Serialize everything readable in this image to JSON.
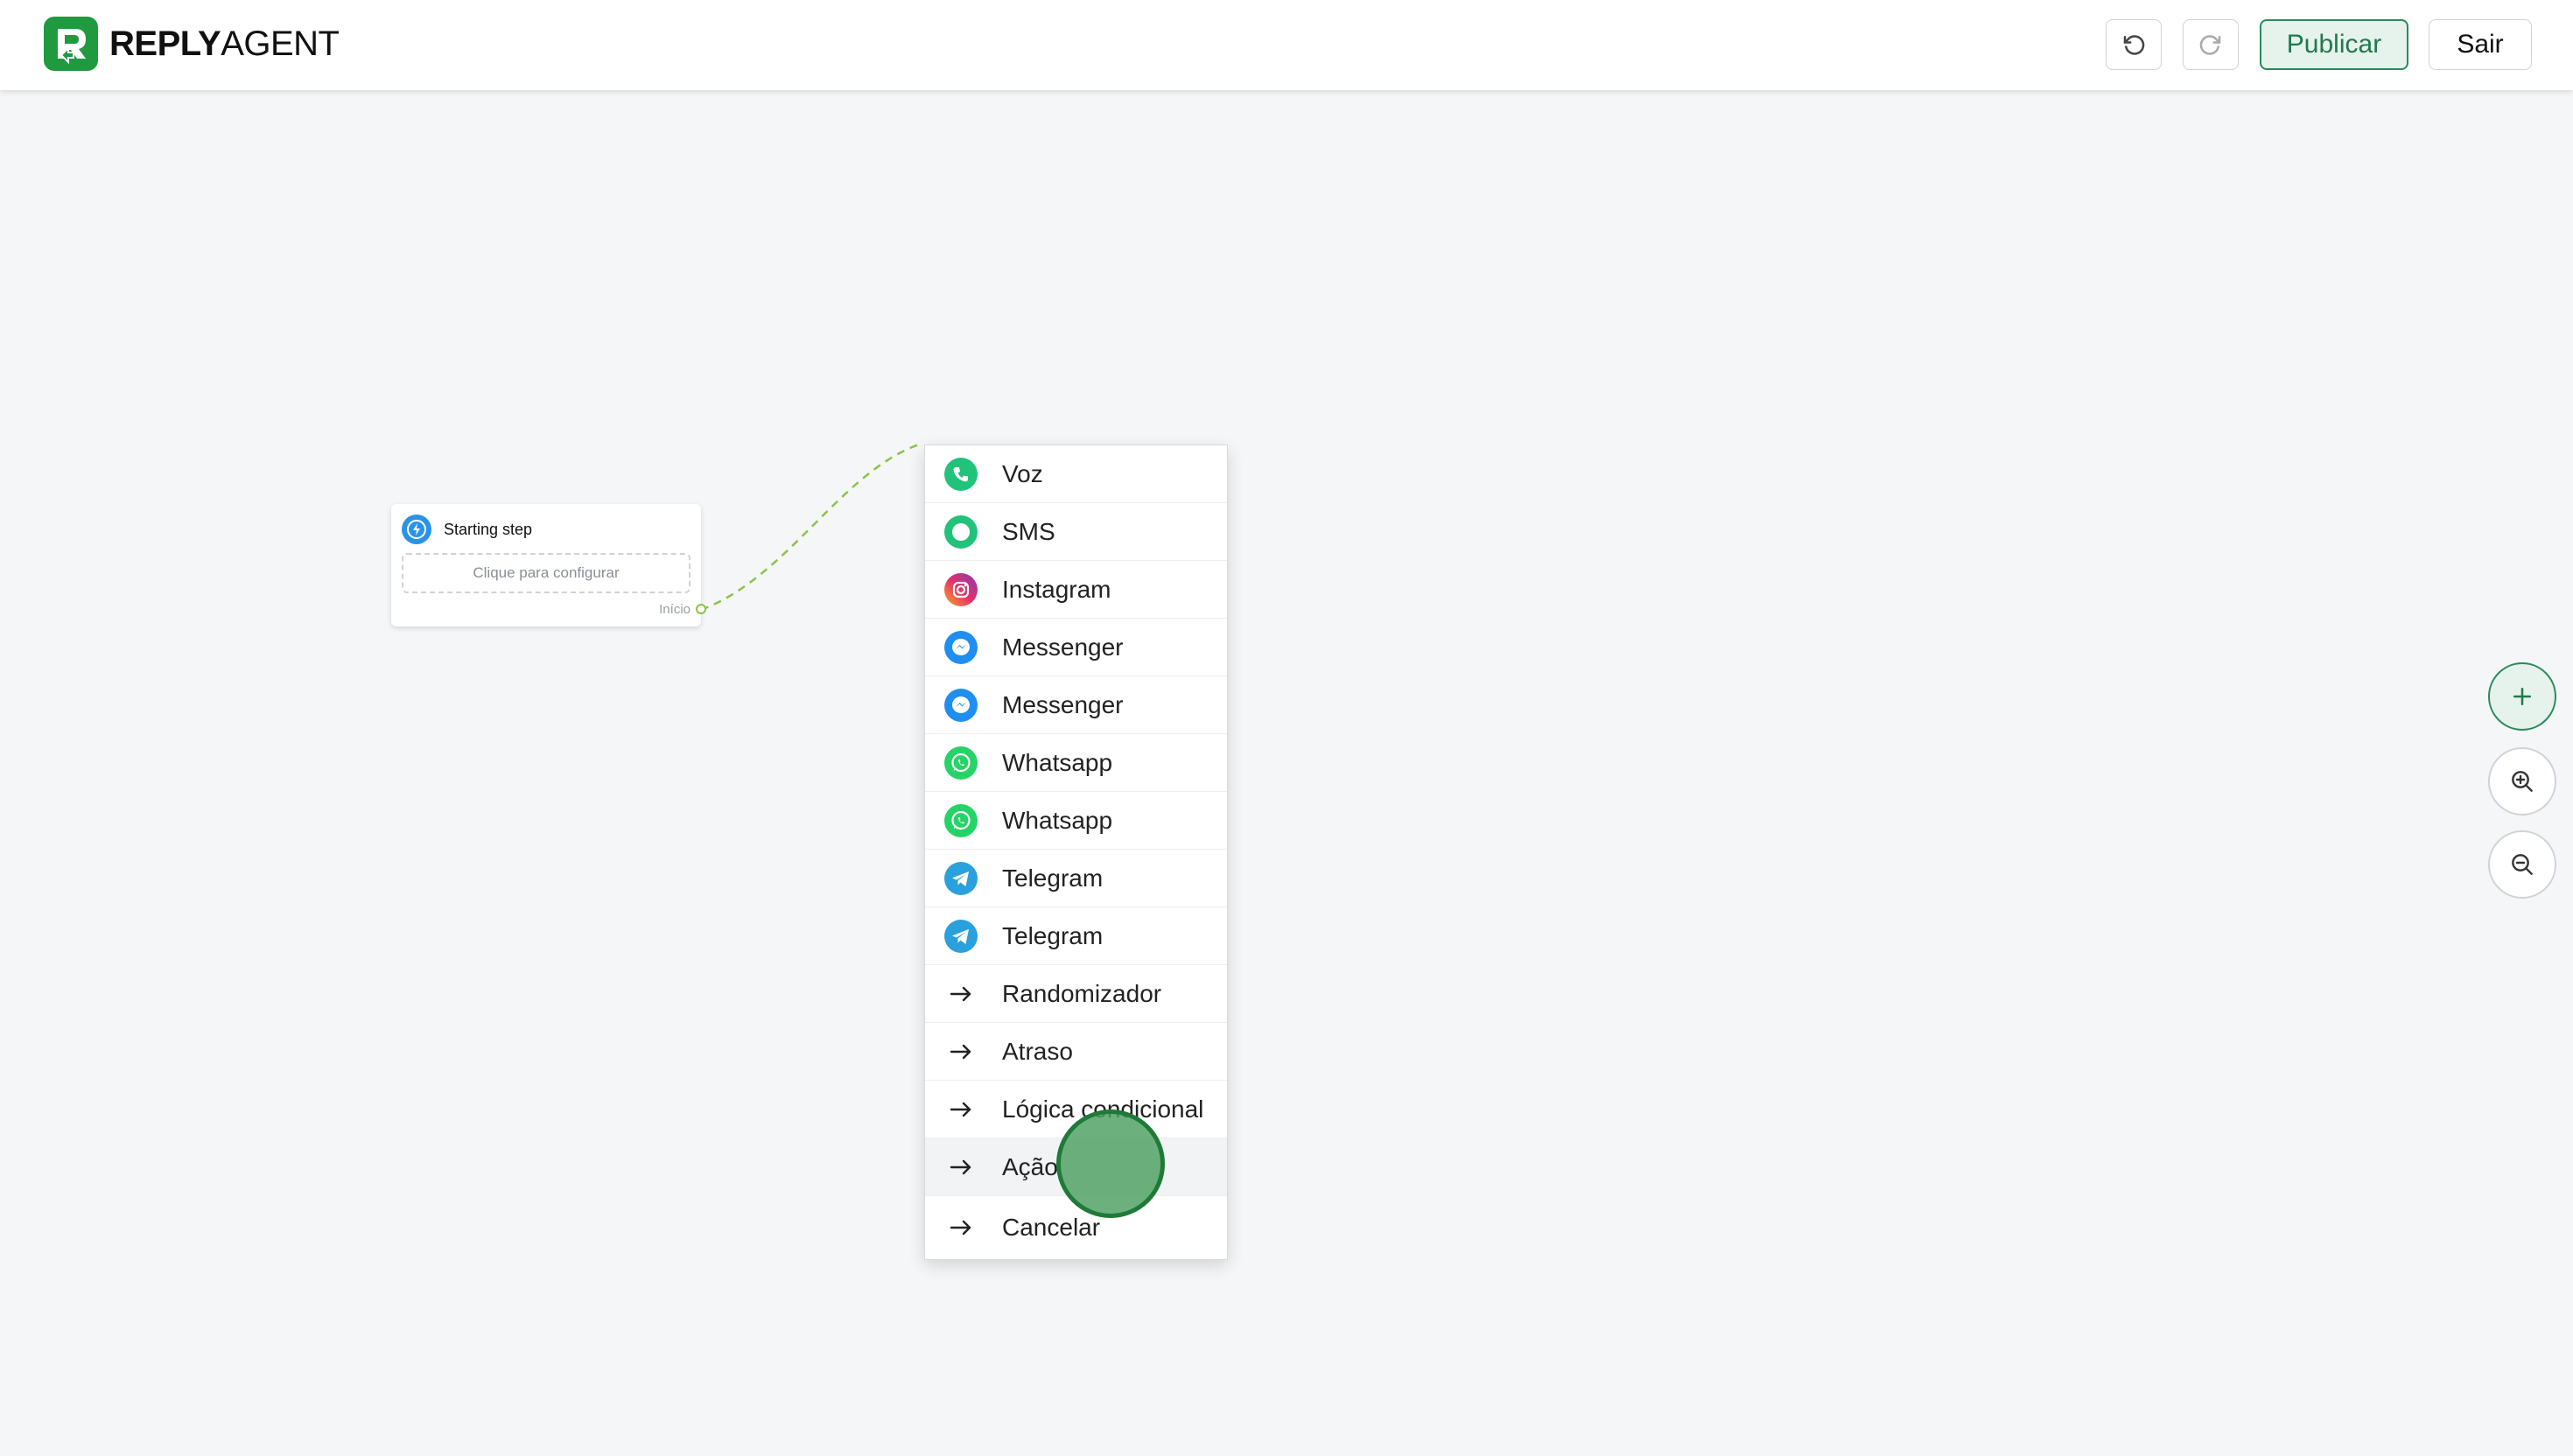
{
  "brand": {
    "name_bold": "REPLY",
    "name_regular": "AGENT",
    "accent_color": "#1f9a3f"
  },
  "toolbar": {
    "undo_icon": "undo-icon",
    "redo_icon": "redo-icon",
    "publish_label": "Publicar",
    "exit_label": "Sair"
  },
  "start_step": {
    "title": "Starting step",
    "config_placeholder": "Clique para configurar",
    "output_label": "Início"
  },
  "menu": {
    "items": [
      {
        "label": "Voz",
        "icon": "phone-icon"
      },
      {
        "label": "SMS",
        "icon": "sms-icon"
      },
      {
        "label": "Instagram",
        "icon": "instagram-icon"
      },
      {
        "label": "Messenger",
        "icon": "messenger-icon"
      },
      {
        "label": "Messenger",
        "icon": "messenger-icon"
      },
      {
        "label": "Whatsapp",
        "icon": "whatsapp-icon"
      },
      {
        "label": "Whatsapp",
        "icon": "whatsapp-icon"
      },
      {
        "label": "Telegram",
        "icon": "telegram-icon"
      },
      {
        "label": "Telegram",
        "icon": "telegram-icon"
      },
      {
        "label": "Randomizador",
        "icon": "arrow-right-icon"
      },
      {
        "label": "Atraso",
        "icon": "arrow-right-icon"
      },
      {
        "label": "Lógica condicional",
        "icon": "arrow-right-icon"
      },
      {
        "label": "Ação",
        "icon": "arrow-right-icon"
      },
      {
        "label": "Cancelar",
        "icon": "arrow-right-icon"
      }
    ]
  },
  "side_controls": {
    "add_icon": "plus-icon",
    "zoom_in_icon": "zoom-in-icon",
    "zoom_out_icon": "zoom-out-icon"
  }
}
